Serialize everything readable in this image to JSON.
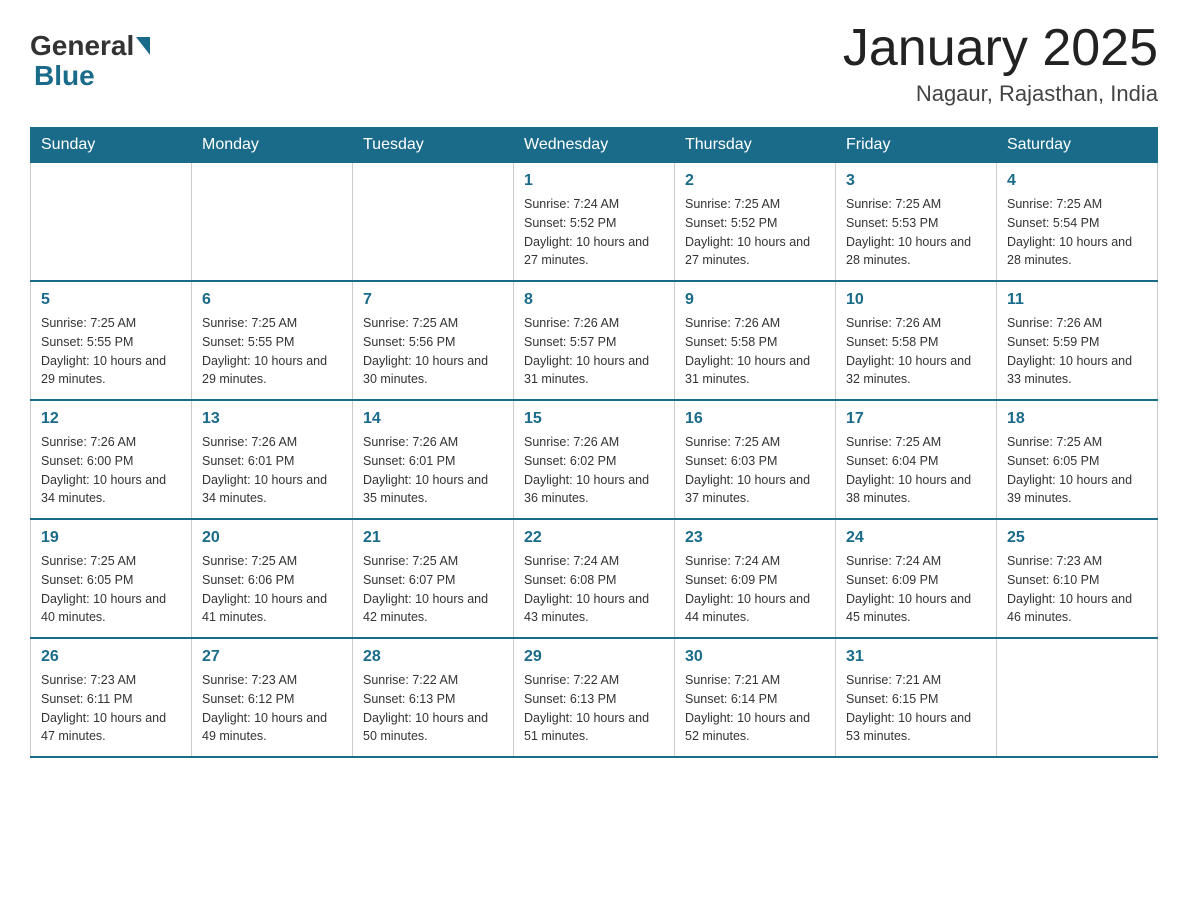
{
  "header": {
    "logo_general": "General",
    "logo_blue": "Blue",
    "month_year": "January 2025",
    "location": "Nagaur, Rajasthan, India"
  },
  "days_of_week": [
    "Sunday",
    "Monday",
    "Tuesday",
    "Wednesday",
    "Thursday",
    "Friday",
    "Saturday"
  ],
  "weeks": [
    [
      {
        "num": "",
        "info": ""
      },
      {
        "num": "",
        "info": ""
      },
      {
        "num": "",
        "info": ""
      },
      {
        "num": "1",
        "info": "Sunrise: 7:24 AM\nSunset: 5:52 PM\nDaylight: 10 hours and 27 minutes."
      },
      {
        "num": "2",
        "info": "Sunrise: 7:25 AM\nSunset: 5:52 PM\nDaylight: 10 hours and 27 minutes."
      },
      {
        "num": "3",
        "info": "Sunrise: 7:25 AM\nSunset: 5:53 PM\nDaylight: 10 hours and 28 minutes."
      },
      {
        "num": "4",
        "info": "Sunrise: 7:25 AM\nSunset: 5:54 PM\nDaylight: 10 hours and 28 minutes."
      }
    ],
    [
      {
        "num": "5",
        "info": "Sunrise: 7:25 AM\nSunset: 5:55 PM\nDaylight: 10 hours and 29 minutes."
      },
      {
        "num": "6",
        "info": "Sunrise: 7:25 AM\nSunset: 5:55 PM\nDaylight: 10 hours and 29 minutes."
      },
      {
        "num": "7",
        "info": "Sunrise: 7:25 AM\nSunset: 5:56 PM\nDaylight: 10 hours and 30 minutes."
      },
      {
        "num": "8",
        "info": "Sunrise: 7:26 AM\nSunset: 5:57 PM\nDaylight: 10 hours and 31 minutes."
      },
      {
        "num": "9",
        "info": "Sunrise: 7:26 AM\nSunset: 5:58 PM\nDaylight: 10 hours and 31 minutes."
      },
      {
        "num": "10",
        "info": "Sunrise: 7:26 AM\nSunset: 5:58 PM\nDaylight: 10 hours and 32 minutes."
      },
      {
        "num": "11",
        "info": "Sunrise: 7:26 AM\nSunset: 5:59 PM\nDaylight: 10 hours and 33 minutes."
      }
    ],
    [
      {
        "num": "12",
        "info": "Sunrise: 7:26 AM\nSunset: 6:00 PM\nDaylight: 10 hours and 34 minutes."
      },
      {
        "num": "13",
        "info": "Sunrise: 7:26 AM\nSunset: 6:01 PM\nDaylight: 10 hours and 34 minutes."
      },
      {
        "num": "14",
        "info": "Sunrise: 7:26 AM\nSunset: 6:01 PM\nDaylight: 10 hours and 35 minutes."
      },
      {
        "num": "15",
        "info": "Sunrise: 7:26 AM\nSunset: 6:02 PM\nDaylight: 10 hours and 36 minutes."
      },
      {
        "num": "16",
        "info": "Sunrise: 7:25 AM\nSunset: 6:03 PM\nDaylight: 10 hours and 37 minutes."
      },
      {
        "num": "17",
        "info": "Sunrise: 7:25 AM\nSunset: 6:04 PM\nDaylight: 10 hours and 38 minutes."
      },
      {
        "num": "18",
        "info": "Sunrise: 7:25 AM\nSunset: 6:05 PM\nDaylight: 10 hours and 39 minutes."
      }
    ],
    [
      {
        "num": "19",
        "info": "Sunrise: 7:25 AM\nSunset: 6:05 PM\nDaylight: 10 hours and 40 minutes."
      },
      {
        "num": "20",
        "info": "Sunrise: 7:25 AM\nSunset: 6:06 PM\nDaylight: 10 hours and 41 minutes."
      },
      {
        "num": "21",
        "info": "Sunrise: 7:25 AM\nSunset: 6:07 PM\nDaylight: 10 hours and 42 minutes."
      },
      {
        "num": "22",
        "info": "Sunrise: 7:24 AM\nSunset: 6:08 PM\nDaylight: 10 hours and 43 minutes."
      },
      {
        "num": "23",
        "info": "Sunrise: 7:24 AM\nSunset: 6:09 PM\nDaylight: 10 hours and 44 minutes."
      },
      {
        "num": "24",
        "info": "Sunrise: 7:24 AM\nSunset: 6:09 PM\nDaylight: 10 hours and 45 minutes."
      },
      {
        "num": "25",
        "info": "Sunrise: 7:23 AM\nSunset: 6:10 PM\nDaylight: 10 hours and 46 minutes."
      }
    ],
    [
      {
        "num": "26",
        "info": "Sunrise: 7:23 AM\nSunset: 6:11 PM\nDaylight: 10 hours and 47 minutes."
      },
      {
        "num": "27",
        "info": "Sunrise: 7:23 AM\nSunset: 6:12 PM\nDaylight: 10 hours and 49 minutes."
      },
      {
        "num": "28",
        "info": "Sunrise: 7:22 AM\nSunset: 6:13 PM\nDaylight: 10 hours and 50 minutes."
      },
      {
        "num": "29",
        "info": "Sunrise: 7:22 AM\nSunset: 6:13 PM\nDaylight: 10 hours and 51 minutes."
      },
      {
        "num": "30",
        "info": "Sunrise: 7:21 AM\nSunset: 6:14 PM\nDaylight: 10 hours and 52 minutes."
      },
      {
        "num": "31",
        "info": "Sunrise: 7:21 AM\nSunset: 6:15 PM\nDaylight: 10 hours and 53 minutes."
      },
      {
        "num": "",
        "info": ""
      }
    ]
  ]
}
